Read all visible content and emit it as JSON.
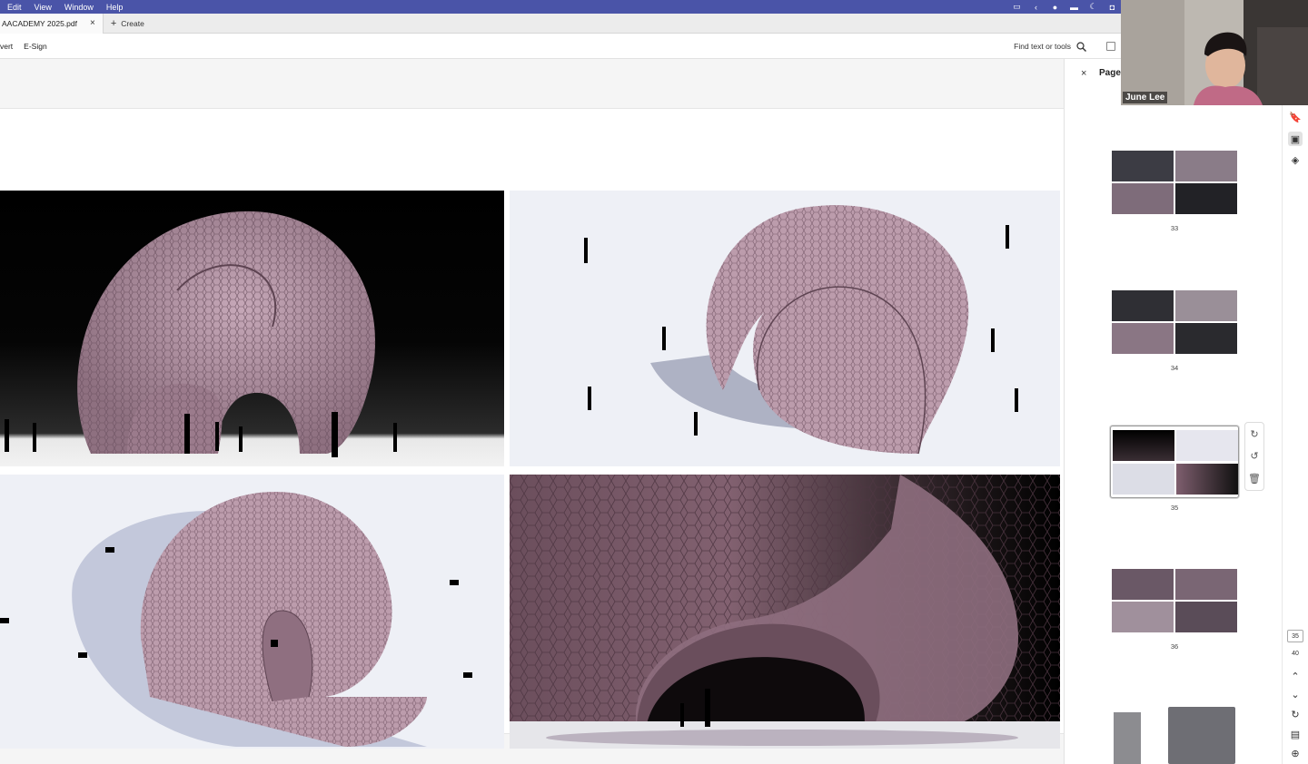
{
  "menubar": {
    "items": [
      "Edit",
      "View",
      "Window",
      "Help"
    ],
    "status_icons": [
      "screen-icon",
      "chevron-left-icon",
      "dot-icon",
      "card-icon",
      "moon-icon",
      "user-icon"
    ],
    "accent": "#4a54a8"
  },
  "tabs": {
    "document_tab": "AACADEMY 2025.pdf",
    "close_symbol": "×",
    "create_label": "Create",
    "create_symbol": "+"
  },
  "toolbar": {
    "items": [
      "vert",
      "E-Sign"
    ],
    "find_label": "Find text or tools"
  },
  "pages_panel": {
    "title": "Pages",
    "close_symbol": "×",
    "thumbnails": [
      {
        "number": "33",
        "selected": false
      },
      {
        "number": "34",
        "selected": false
      },
      {
        "number": "35",
        "selected": true
      },
      {
        "number": "36",
        "selected": false
      }
    ],
    "thumb_tools": [
      "rotate-clockwise-icon",
      "rotate-counterclockwise-icon",
      "delete-icon"
    ]
  },
  "page_nav": {
    "current": "35",
    "total": "40"
  },
  "webcam": {
    "name": "June Lee"
  },
  "document": {
    "renders": [
      "render-night-front-view",
      "render-white-perspective-view",
      "render-top-view",
      "render-closeup-entrance-view"
    ],
    "shell_color": "#b99aaa"
  }
}
